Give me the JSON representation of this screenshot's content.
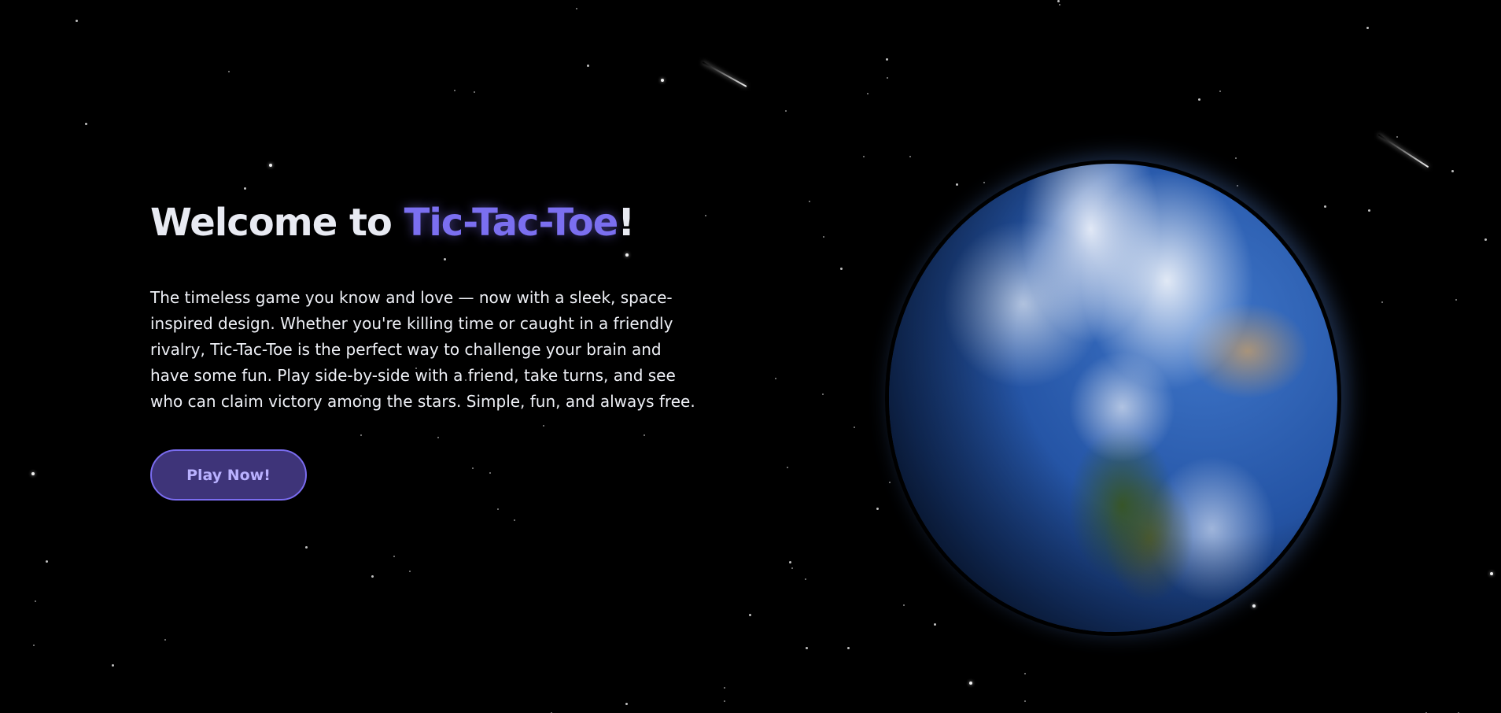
{
  "hero": {
    "title_prefix": "Welcome to ",
    "title_accent": "Tic-Tac-Toe",
    "title_suffix": "!",
    "description": "The timeless game you know and love — now with a sleek, space-inspired design. Whether you're killing time or caught in a friendly rivalry, Tic-Tac-Toe is the perfect way to challenge your brain and have some fun. Play side-by-side with a friend, take turns, and see who can claim victory among the stars. Simple, fun, and always free.",
    "cta_label": "Play Now!"
  },
  "theme": {
    "background": "#000000",
    "accent": "#7b6ff0",
    "button_fill": "#3e3479",
    "button_text": "#b9b1ff",
    "text": "#eef0f6"
  },
  "decor": {
    "background_icon": "starfield",
    "planet_icon": "earth-globe-icon",
    "meteor_icon": "shooting-star-icon"
  }
}
